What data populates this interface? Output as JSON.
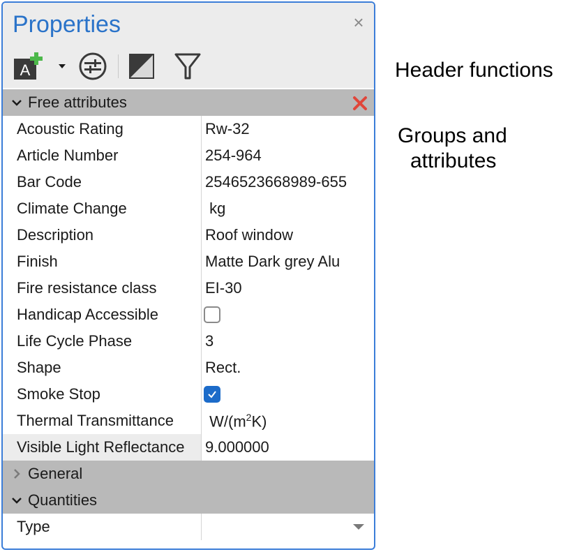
{
  "panel": {
    "title": "Properties",
    "close_glyph": "×"
  },
  "toolbar": {
    "buttons": [
      {
        "icon": "add-attribute-icon"
      },
      {
        "icon": "dropdown-caret-icon"
      },
      {
        "icon": "adjust-settings-icon"
      },
      {
        "icon": "gradient-square-icon"
      },
      {
        "icon": "filter-icon"
      }
    ]
  },
  "groups": {
    "free_attributes": {
      "label": "Free attributes",
      "expanded": true,
      "rows": [
        {
          "name": "Acoustic Rating",
          "value": "Rw-32"
        },
        {
          "name": "Article Number",
          "value": "254-964"
        },
        {
          "name": "Bar Code",
          "value": "2546523668989-655"
        },
        {
          "name": "Climate Change",
          "value": " kg"
        },
        {
          "name": "Description",
          "value": "Roof window"
        },
        {
          "name": "Finish",
          "value": "Matte Dark grey Alu"
        },
        {
          "name": "Fire resistance class",
          "value": "EI-30"
        },
        {
          "name": "Handicap Accessible",
          "checked": false
        },
        {
          "name": "Life Cycle Phase",
          "value": "3"
        },
        {
          "name": "Shape",
          "value": "Rect."
        },
        {
          "name": "Smoke Stop",
          "checked": true
        },
        {
          "name": "Thermal Transmittance",
          "value_pre": " W/(m",
          "value_sup": "2",
          "value_post": "K)"
        },
        {
          "name": "Visible Light Reflectance",
          "value": "9.000000"
        }
      ]
    },
    "general": {
      "label": "General",
      "expanded": false
    },
    "quantities": {
      "label": "Quantities",
      "expanded": true,
      "rows": [
        {
          "name": "Type",
          "value": ""
        }
      ]
    }
  },
  "annotations": {
    "header": "Header functions",
    "groups_line1": "Groups and",
    "groups_line2": "attributes"
  },
  "colors": {
    "accent": "#2a73c9",
    "border": "#3b7dd8",
    "section_bg": "#b9b9b9",
    "toolbar_bg": "#ececec",
    "checkbox_checked": "#1c6bc9",
    "remove_red": "#e0463a",
    "plus_green": "#4cb84a"
  }
}
